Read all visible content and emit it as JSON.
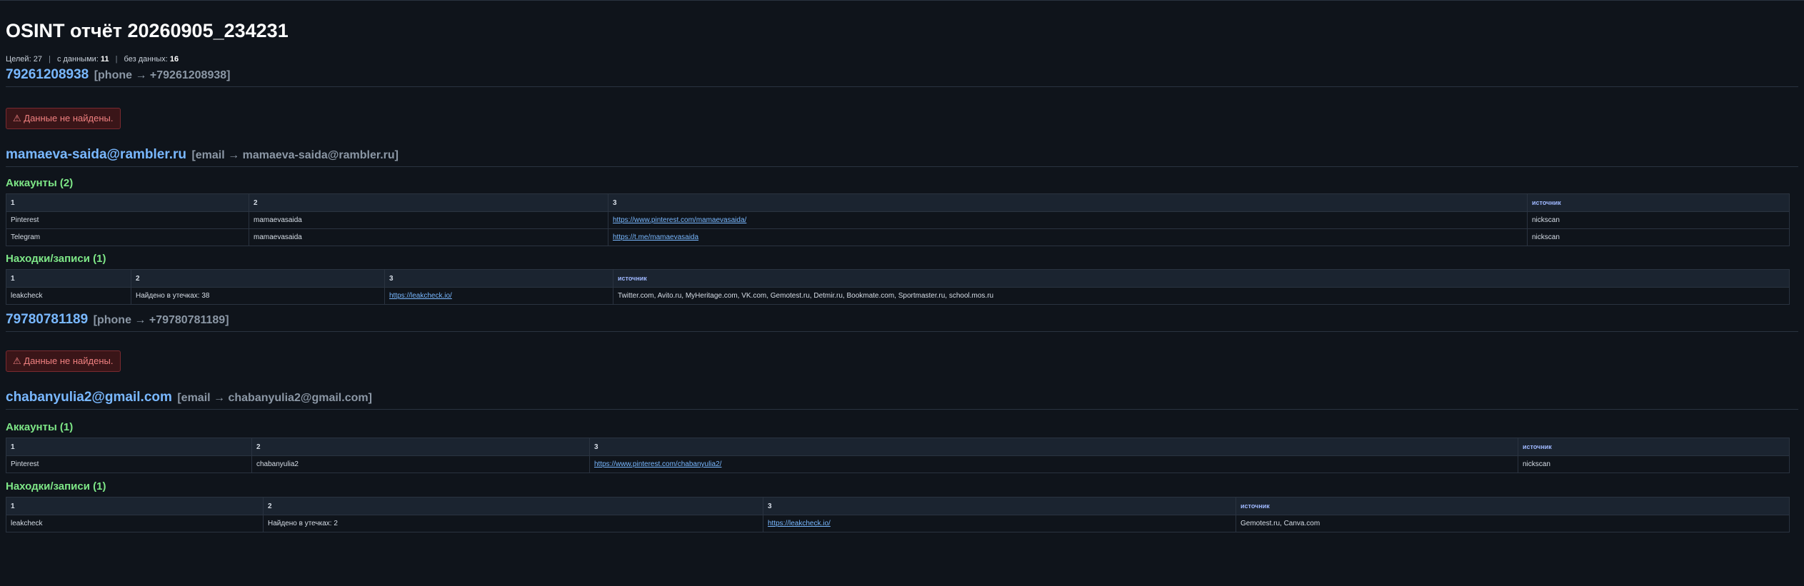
{
  "title": "OSINT отчёт 20260905_234231",
  "summary": {
    "targets_label": "Целей:",
    "targets_value": "27",
    "with_data_label": "с данными:",
    "with_data_value": "11",
    "no_data_label": "без данных:",
    "no_data_value": "16"
  },
  "colors": {
    "accent": "#79b8ff",
    "section": "#7ee787",
    "alert": "#f08080",
    "background": "#0f141b"
  },
  "targets": [
    {
      "value": "79261208938",
      "meta": "[phone → +79261208938]",
      "alert": "⚠ Данные не найдены."
    },
    {
      "value": "mamaeva-saida@rambler.ru",
      "meta": "[email → mamaeva-saida@rambler.ru]",
      "accounts": {
        "title": "Аккаунты (2)",
        "headers": [
          "1",
          "2",
          "3",
          "источник"
        ],
        "rows": [
          [
            "Pinterest",
            "mamaevasaida",
            "https://www.pinterest.com/mamaevasaida/",
            "nickscan"
          ],
          [
            "Telegram",
            "mamaevasaida",
            "https://t.me/mamaevasaida",
            "nickscan"
          ]
        ]
      },
      "findings": {
        "title": "Находки/записи (1)",
        "headers": [
          "1",
          "2",
          "3",
          "источник"
        ],
        "rows": [
          [
            "leakcheck",
            "Найдено в утечках: 38",
            "https://leakcheck.io/",
            "Twitter.com, Avito.ru, MyHeritage.com, VK.com, Gemotest.ru, Detmir.ru, Bookmate.com, Sportmaster.ru, school.mos.ru"
          ]
        ]
      }
    },
    {
      "value": "79780781189",
      "meta": "[phone → +79780781189]",
      "alert": "⚠ Данные не найдены."
    },
    {
      "value": "chabanyulia2@gmail.com",
      "meta": "[email → chabanyulia2@gmail.com]",
      "accounts": {
        "title": "Аккаунты (1)",
        "headers": [
          "1",
          "2",
          "3",
          "источник"
        ],
        "rows": [
          [
            "Pinterest",
            "chabanyulia2",
            "https://www.pinterest.com/chabanyulia2/",
            "nickscan"
          ]
        ]
      },
      "findings": {
        "title": "Находки/записи (1)",
        "headers": [
          "1",
          "2",
          "3",
          "источник"
        ],
        "rows": [
          [
            "leakcheck",
            "Найдено в утечках: 2",
            "https://leakcheck.io/",
            "Gemotest.ru, Canva.com"
          ]
        ]
      }
    }
  ]
}
